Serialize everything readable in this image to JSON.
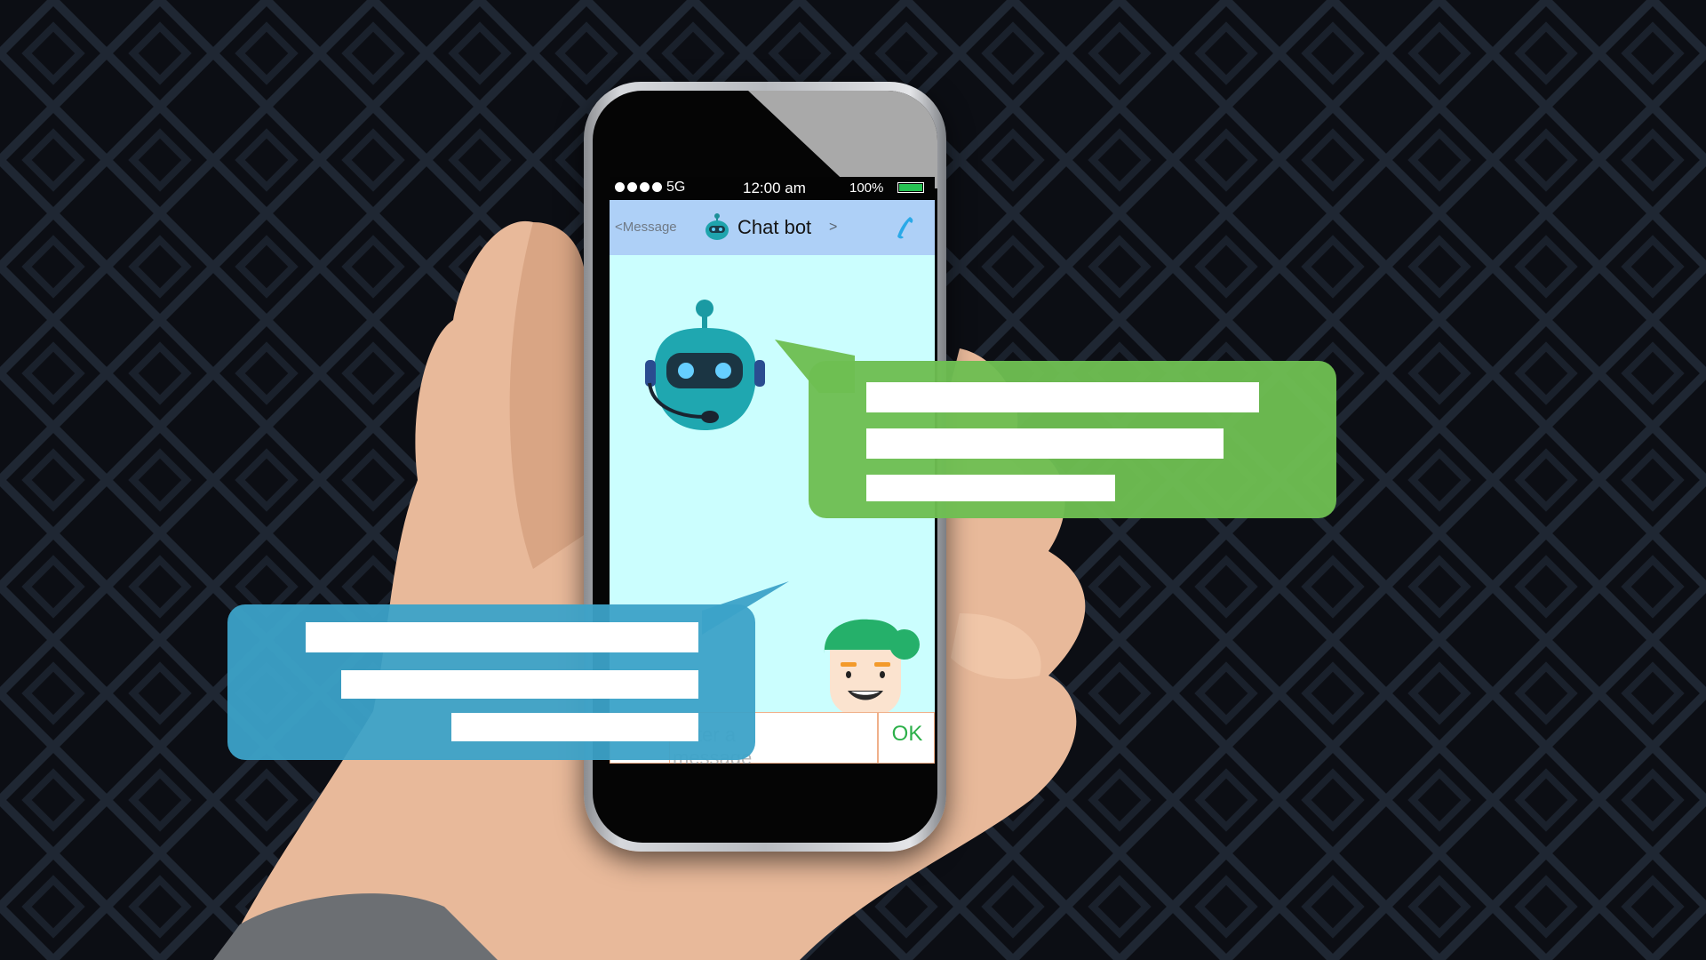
{
  "status_bar": {
    "network": "5G",
    "time": "12:00 am",
    "battery": "100%",
    "battery_level": 1.0,
    "battery_color": "#27c253"
  },
  "header": {
    "back_label": "Message",
    "title": "Chat bot",
    "avatar_icon": "robot-icon",
    "action_icon": "phone-icon"
  },
  "input": {
    "placeholder": "Enter a message",
    "send_label": "OK"
  },
  "colors": {
    "bot_bubble": "#6ebe52",
    "user_bubble": "#3ca2c8",
    "screen_bg": "#cbfefe",
    "header_bg": "#aed0f7"
  }
}
